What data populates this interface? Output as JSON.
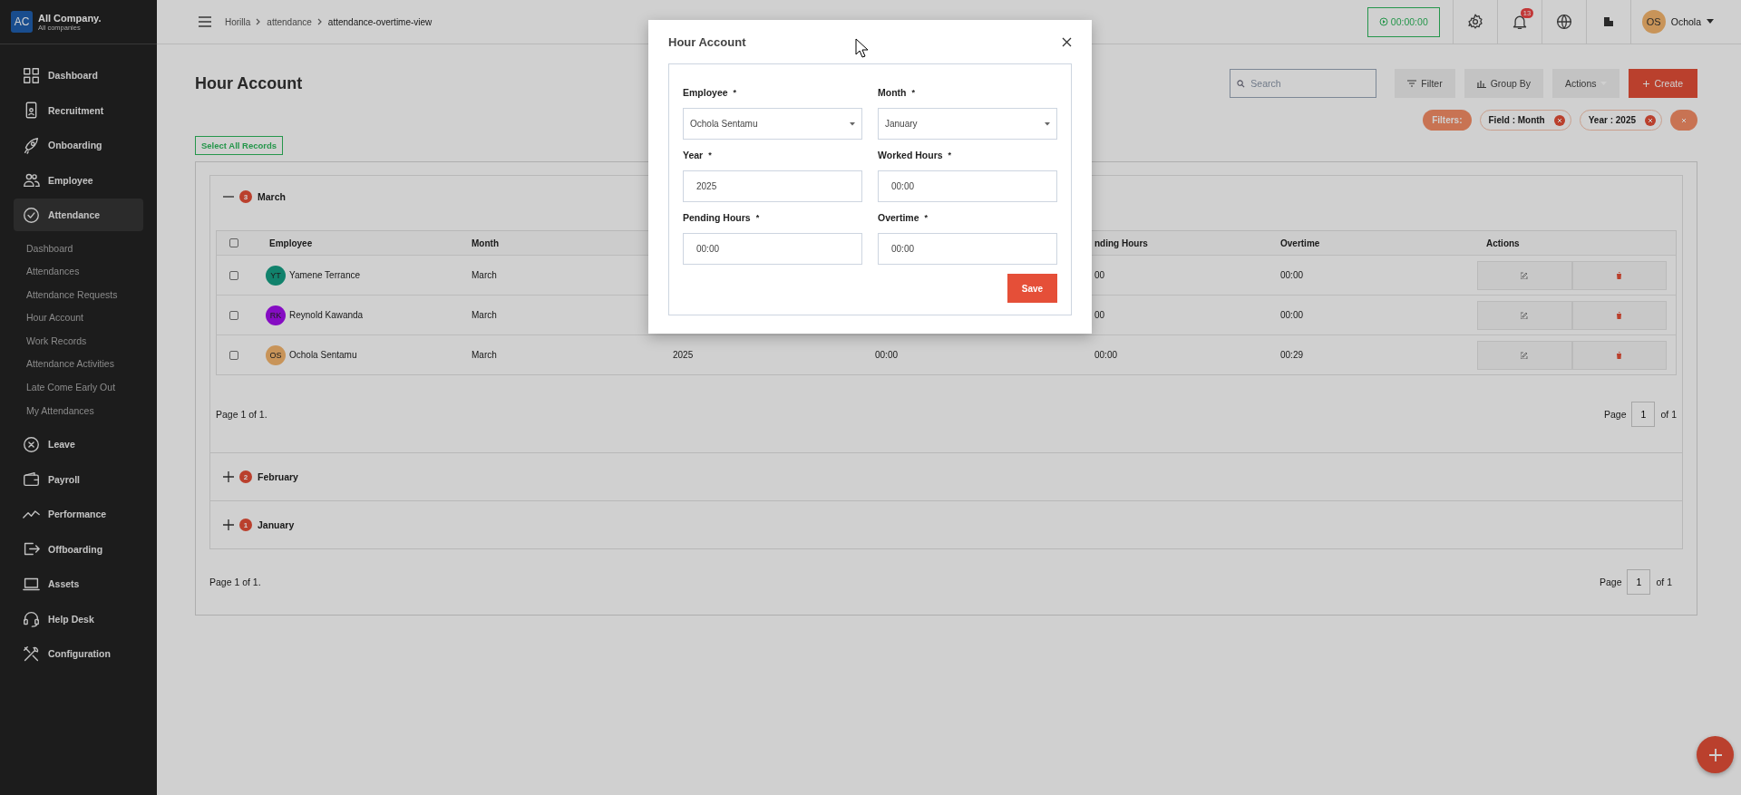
{
  "company": {
    "initials": "AC",
    "name": "All Company.",
    "subtitle": "All companies"
  },
  "sidebar": {
    "items": [
      {
        "label": "Dashboard",
        "selected": false
      },
      {
        "label": "Recruitment",
        "selected": false
      },
      {
        "label": "Onboarding",
        "selected": false
      },
      {
        "label": "Employee",
        "selected": false
      },
      {
        "label": "Attendance",
        "selected": true,
        "children": [
          {
            "label": "Dashboard"
          },
          {
            "label": "Attendances"
          },
          {
            "label": "Attendance Requests"
          },
          {
            "label": "Hour Account"
          },
          {
            "label": "Work Records"
          },
          {
            "label": "Attendance Activities"
          },
          {
            "label": "Late Come Early Out"
          },
          {
            "label": "My Attendances"
          }
        ]
      },
      {
        "label": "Leave",
        "selected": false
      },
      {
        "label": "Payroll",
        "selected": false
      },
      {
        "label": "Performance",
        "selected": false
      },
      {
        "label": "Offboarding",
        "selected": false
      },
      {
        "label": "Assets",
        "selected": false
      },
      {
        "label": "Help Desk",
        "selected": false
      },
      {
        "label": "Configuration",
        "selected": false
      }
    ]
  },
  "header": {
    "breadcrumbs": [
      "Horilla",
      "attendance",
      "attendance-overtime-view"
    ],
    "timer": "00:00:00",
    "notification_count": "13",
    "user": {
      "initials": "OS",
      "name": "Ochola"
    }
  },
  "page": {
    "title": "Hour Account",
    "search": {
      "placeholder": "Search"
    },
    "buttons": {
      "filter": "Filter",
      "group_by": "Group By",
      "actions": "Actions",
      "create": "Create"
    },
    "filters": {
      "label": "Filters:",
      "chips": [
        "Field : Month",
        "Year : 2025"
      ]
    },
    "select_all": "Select All Records",
    "groups": [
      {
        "label": "March",
        "count": "3",
        "expanded": true,
        "all_selected": false,
        "columns": {
          "employee": "Employee",
          "month": "Month",
          "pending_hours": "nding Hours",
          "overtime": "Overtime",
          "actions": "Actions"
        },
        "rows": [
          {
            "selected": false,
            "initials": "YT",
            "color": "#12826c",
            "employee": "Yamene Terrance",
            "month": "March",
            "pending_hours": "00",
            "overtime": "00:00"
          },
          {
            "selected": false,
            "initials": "RK",
            "color": "#860cc4",
            "employee": "Reynold Kawanda",
            "month": "March",
            "pending_hours": "00",
            "overtime": "00:00"
          },
          {
            "selected": false,
            "initials": "OS",
            "color": "#c8945a",
            "employee": "Ochola Sentamu",
            "month": "March",
            "year": "2025",
            "worked_hours": "00:00",
            "pending_hours": "00:00",
            "overtime": "00:29"
          }
        ],
        "summary": "Page 1 of 1.",
        "pagination": {
          "label": "Page",
          "page": "1",
          "total": "of 1"
        }
      },
      {
        "label": "February",
        "count": "2",
        "expanded": false
      },
      {
        "label": "January",
        "count": "1",
        "expanded": false
      }
    ],
    "summary": "Page 1 of 1.",
    "pagination": {
      "label": "Page",
      "page": "1",
      "total": "of 1"
    }
  },
  "modal": {
    "title": "Hour Account",
    "fields": [
      {
        "label": "Employee",
        "marker": "*",
        "kind": "select",
        "value": "Ochola Sentamu"
      },
      {
        "label": "Month",
        "marker": "*",
        "kind": "select",
        "value": "January"
      },
      {
        "label": "Year",
        "marker": "*",
        "kind": "text",
        "value": "2025"
      },
      {
        "label": "Worked Hours",
        "marker": "*",
        "kind": "text",
        "value": "00:00"
      },
      {
        "label": "Pending Hours",
        "marker": "*",
        "kind": "text",
        "value": "00:00"
      },
      {
        "label": "Overtime",
        "marker": "*",
        "kind": "text",
        "value": "00:00"
      }
    ],
    "save": "Save"
  }
}
